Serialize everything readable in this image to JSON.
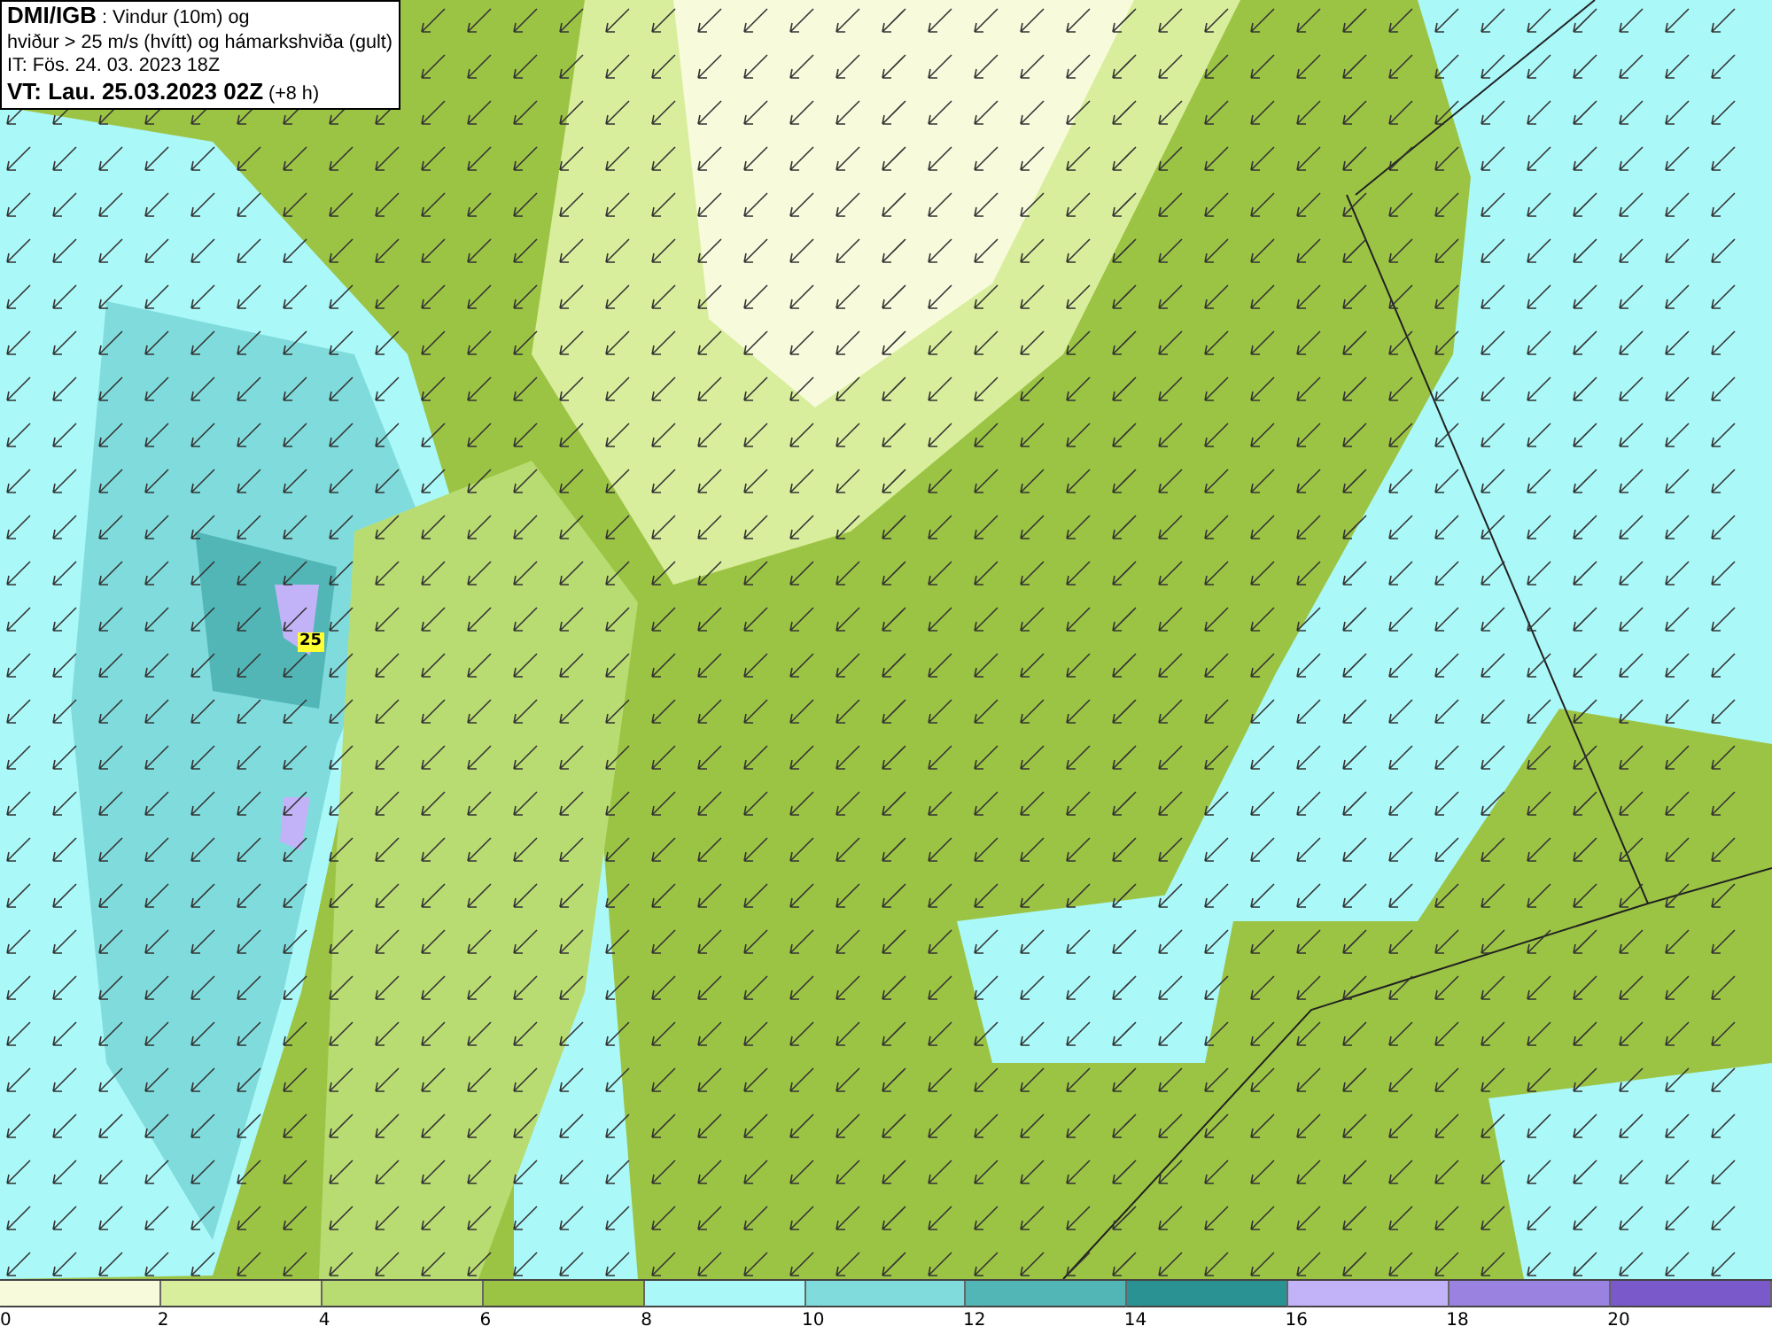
{
  "header": {
    "lines": [
      "**DMI/IGB** : Vindur (10m) og",
      "hviður > 25 m/s (hvítt) og hámarkshviða (gult)",
      "IT: Fös. 24. 03. 2023 18Z",
      "**VT: Lau. 25.03.2023 02Z** (+8 h)"
    ]
  },
  "map": {
    "gust_label": "25"
  },
  "legend": [
    {
      "label": "0",
      "color": "#f7fbdc"
    },
    {
      "label": "2",
      "color": "#d9ee9c"
    },
    {
      "label": "4",
      "color": "#b9dc72"
    },
    {
      "label": "6",
      "color": "#9cc444"
    },
    {
      "label": "8",
      "color": "#aaf8f8"
    },
    {
      "label": "10",
      "color": "#80dcdc"
    },
    {
      "label": "12",
      "color": "#52b6b6"
    },
    {
      "label": "14",
      "color": "#2a9292"
    },
    {
      "label": "16",
      "color": "#c2b2f8"
    },
    {
      "label": "18",
      "color": "#9a82e0"
    },
    {
      "label": "20",
      "color": "#7a5acb"
    }
  ]
}
